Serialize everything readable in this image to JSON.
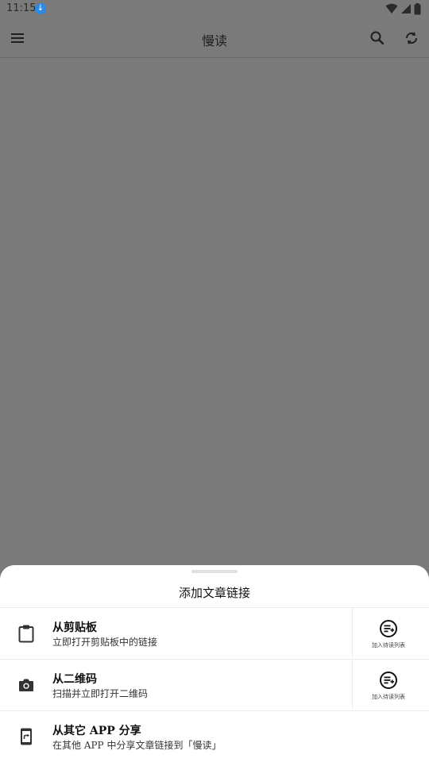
{
  "status": {
    "time": "11:15"
  },
  "appbar": {
    "title": "慢读"
  },
  "sheet": {
    "title": "添加文章链接",
    "items": [
      {
        "title": "从剪贴板",
        "subtitle": "立即打开剪贴板中的链接",
        "icon": "clipboard-icon",
        "action": "加入待读列表"
      },
      {
        "title": "从二维码",
        "subtitle": "扫描并立即打开二维码",
        "icon": "camera-icon",
        "action": "加入待读列表"
      },
      {
        "title": "从其它 APP 分享",
        "subtitle": "在其他 APP 中分享文章链接到「慢读」",
        "icon": "share-phone-icon"
      }
    ]
  }
}
